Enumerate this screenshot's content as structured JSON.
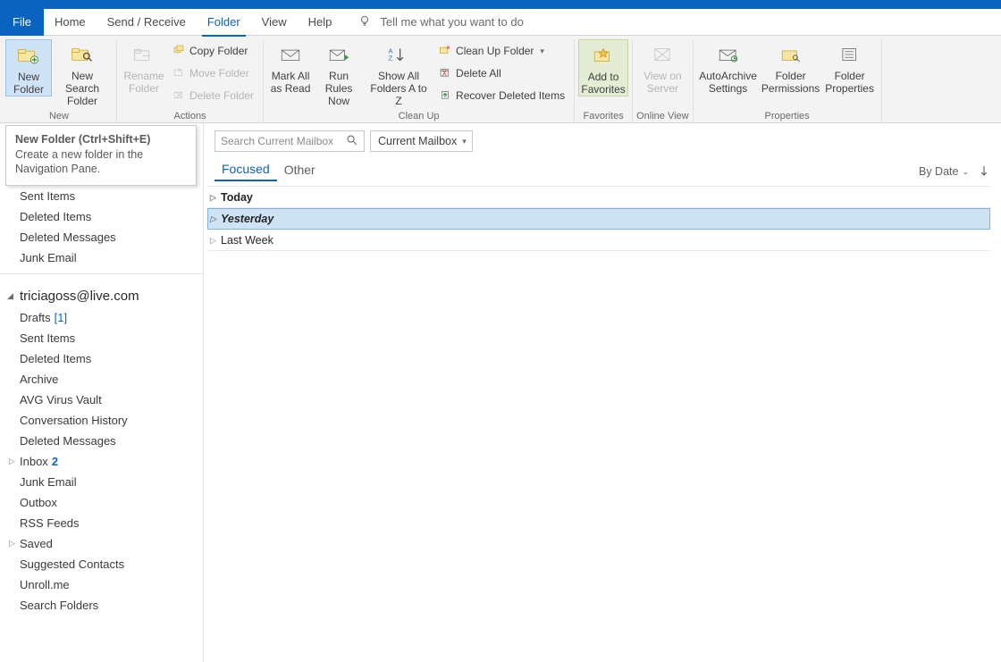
{
  "tabs": {
    "file": "File",
    "home": "Home",
    "send_receive": "Send / Receive",
    "folder": "Folder",
    "view": "View",
    "help": "Help",
    "tell_me": "Tell me what you want to do"
  },
  "ribbon": {
    "groups": {
      "new": {
        "label": "New",
        "new_folder_l1": "New",
        "new_folder_l2": "Folder",
        "new_search_l1": "New Search",
        "new_search_l2": "Folder"
      },
      "actions": {
        "label": "Actions",
        "rename_l1": "Rename",
        "rename_l2": "Folder",
        "copy": "Copy Folder",
        "move": "Move Folder",
        "delete": "Delete Folder"
      },
      "cleanup": {
        "label": "Clean Up",
        "mark_l1": "Mark All",
        "mark_l2": "as Read",
        "rules_l1": "Run Rules",
        "rules_l2": "Now",
        "showall_l1": "Show All",
        "showall_l2": "Folders A to Z",
        "cleanup_folder": "Clean Up Folder",
        "delete_all": "Delete All",
        "recover": "Recover Deleted Items"
      },
      "favorites": {
        "label": "Favorites",
        "add_l1": "Add to",
        "add_l2": "Favorites"
      },
      "online": {
        "label": "Online View",
        "view_l1": "View on",
        "view_l2": "Server"
      },
      "properties": {
        "label": "Properties",
        "auto_l1": "AutoArchive",
        "auto_l2": "Settings",
        "perm_l1": "Folder",
        "perm_l2": "Permissions",
        "props_l1": "Folder",
        "props_l2": "Properties"
      }
    }
  },
  "tooltip": {
    "title": "New Folder (Ctrl+Shift+E)",
    "body": "Create a new folder in the Navigation Pane."
  },
  "nav": {
    "top_folders": {
      "sent": "Sent Items",
      "deleted": "Deleted Items",
      "deleted_msgs": "Deleted Messages",
      "junk": "Junk Email"
    },
    "account": "triciagoss@live.com",
    "folders": {
      "drafts_label": "Drafts",
      "drafts_count": "[1]",
      "sent": "Sent Items",
      "deleted": "Deleted Items",
      "archive": "Archive",
      "avg": "AVG Virus Vault",
      "conv": "Conversation History",
      "deleted_msgs": "Deleted Messages",
      "inbox_label": "Inbox",
      "inbox_count": "2",
      "junk": "Junk Email",
      "outbox": "Outbox",
      "rss": "RSS Feeds",
      "saved": "Saved",
      "suggested": "Suggested Contacts",
      "unroll": "Unroll.me",
      "search": "Search Folders"
    }
  },
  "list": {
    "search_placeholder": "Search Current Mailbox",
    "scope": "Current Mailbox",
    "tabs": {
      "focused": "Focused",
      "other": "Other"
    },
    "sort_label": "By Date",
    "groups": {
      "today": "Today",
      "yesterday": "Yesterday",
      "lastweek": "Last Week"
    }
  }
}
